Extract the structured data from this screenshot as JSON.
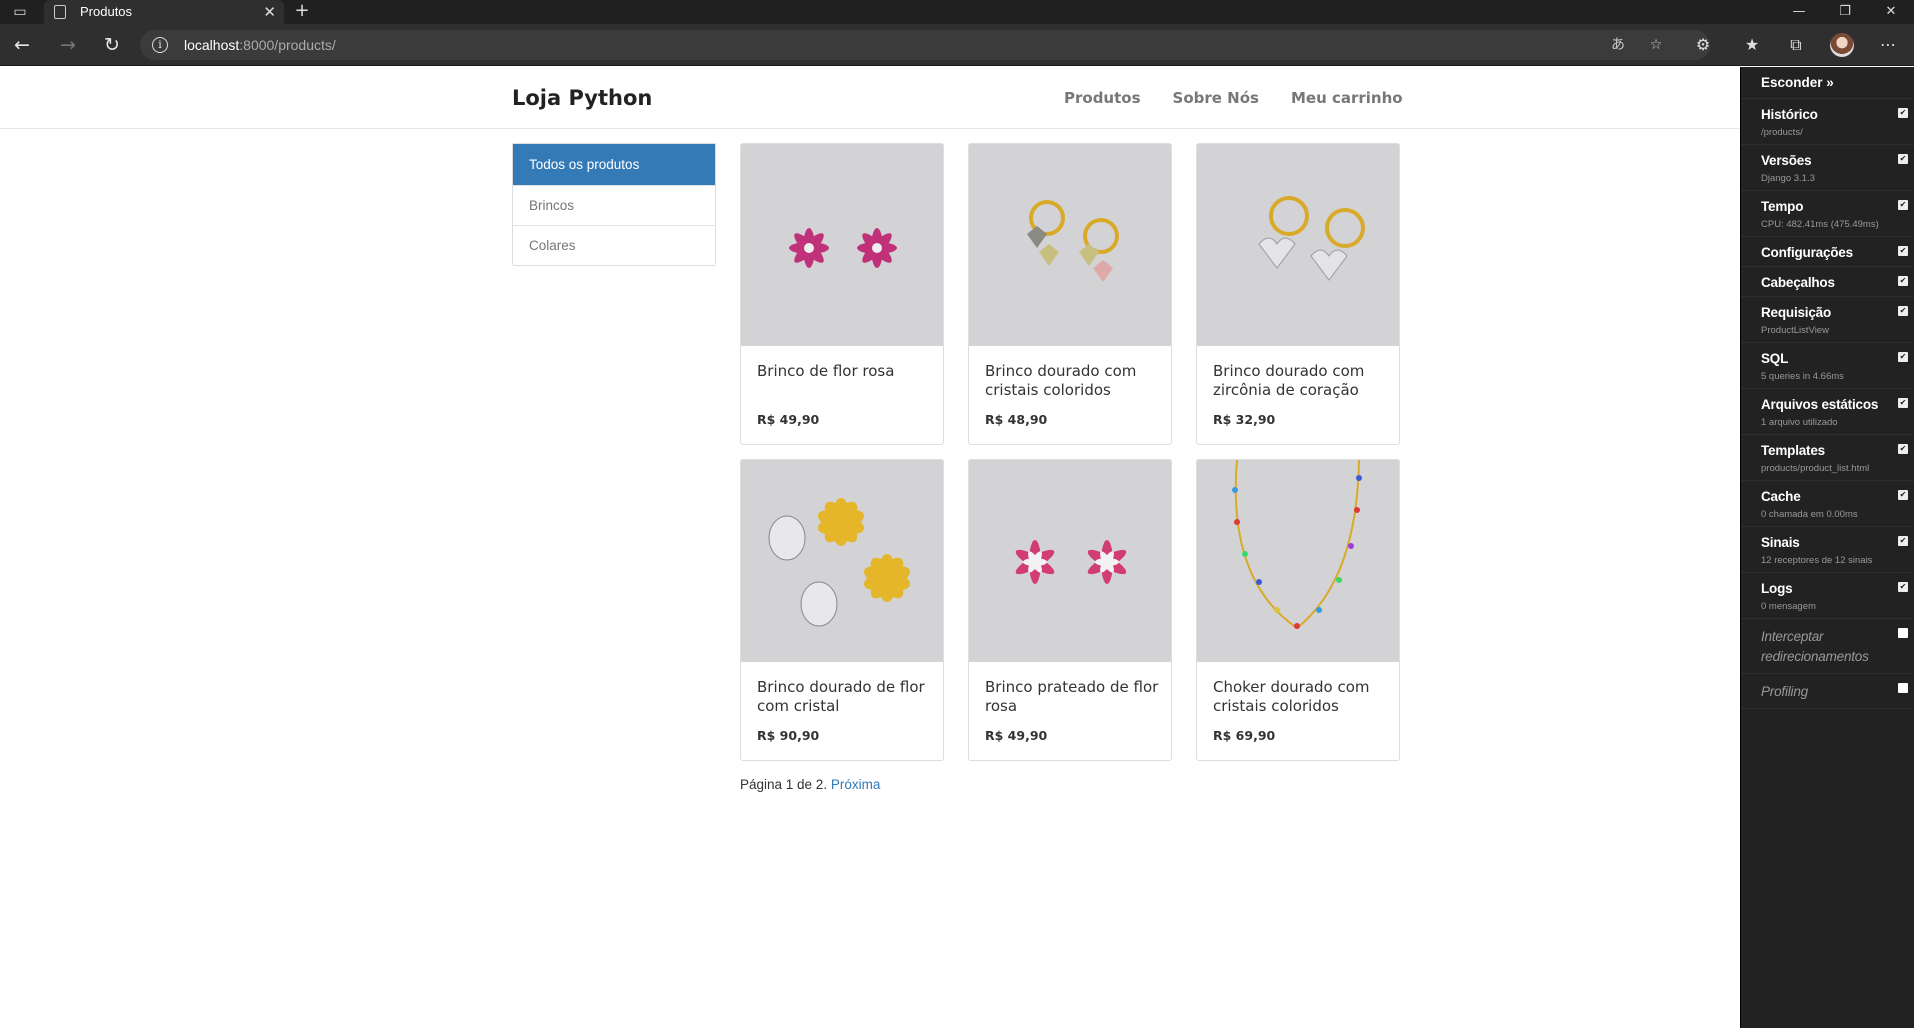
{
  "browser": {
    "tab_title": "Produtos",
    "new_tab": "+",
    "url_host": "localhost",
    "url_path": ":8000/products/",
    "icons": {
      "back": "arrow-left",
      "forward": "arrow-right",
      "refresh": "refresh",
      "info": "info",
      "translate": "translate",
      "favorite_add": "star-plus",
      "extensions": "puzzle",
      "favorites": "star",
      "collections": "collections",
      "menu": "ellipsis"
    }
  },
  "site": {
    "brand": "Loja Python",
    "nav": [
      "Produtos",
      "Sobre Nós",
      "Meu carrinho"
    ]
  },
  "categories": [
    {
      "label": "Todos os produtos",
      "active": true
    },
    {
      "label": "Brincos",
      "active": false
    },
    {
      "label": "Colares",
      "active": false
    }
  ],
  "products": [
    {
      "name": "Brinco de flor rosa",
      "price": "R$ 49,90",
      "image": "pink-flower-earrings"
    },
    {
      "name": "Brinco dourado com cristais coloridos",
      "price": "R$ 48,90",
      "image": "gold-hoops-colored-crystals"
    },
    {
      "name": "Brinco dourado com zircônia de coração",
      "price": "R$ 32,90",
      "image": "gold-hoops-heart-zirconia"
    },
    {
      "name": "Brinco dourado de flor com cristal",
      "price": "R$ 90,90",
      "image": "gold-flower-crystal-drop"
    },
    {
      "name": "Brinco prateado de flor rosa",
      "price": "R$ 49,90",
      "image": "silver-pink-flower-earrings"
    },
    {
      "name": "Choker dourado com cristais coloridos",
      "price": "R$ 69,90",
      "image": "gold-choker-colored-crystals"
    }
  ],
  "pagination": {
    "text": "Página 1 de 2.",
    "next": "Próxima"
  },
  "debug_toolbar": {
    "hide_label": "Esconder »",
    "panels": [
      {
        "title": "Histórico",
        "subtitle": "/products/",
        "checked": true
      },
      {
        "title": "Versões",
        "subtitle": "Django 3.1.3",
        "checked": true
      },
      {
        "title": "Tempo",
        "subtitle": "CPU: 482.41ms (475.49ms)",
        "checked": true
      },
      {
        "title": "Configurações",
        "subtitle": "",
        "checked": true
      },
      {
        "title": "Cabeçalhos",
        "subtitle": "",
        "checked": true
      },
      {
        "title": "Requisição",
        "subtitle": "ProductListView",
        "checked": true
      },
      {
        "title": "SQL",
        "subtitle": "5 queries in 4.66ms",
        "checked": true
      },
      {
        "title": "Arquivos estáticos",
        "subtitle": "1 arquivo utilizado",
        "checked": true
      },
      {
        "title": "Templates",
        "subtitle": "products/product_list.html",
        "checked": true
      },
      {
        "title": "Cache",
        "subtitle": "0 chamada em 0.00ms",
        "checked": true
      },
      {
        "title": "Sinais",
        "subtitle": "12 receptores de 12 sinais",
        "checked": true
      },
      {
        "title": "Logs",
        "subtitle": "0 mensagem",
        "checked": true
      },
      {
        "title": "Interceptar redirecionamentos",
        "subtitle": "",
        "checked": false
      },
      {
        "title": "Profiling",
        "subtitle": "",
        "checked": false
      }
    ]
  }
}
